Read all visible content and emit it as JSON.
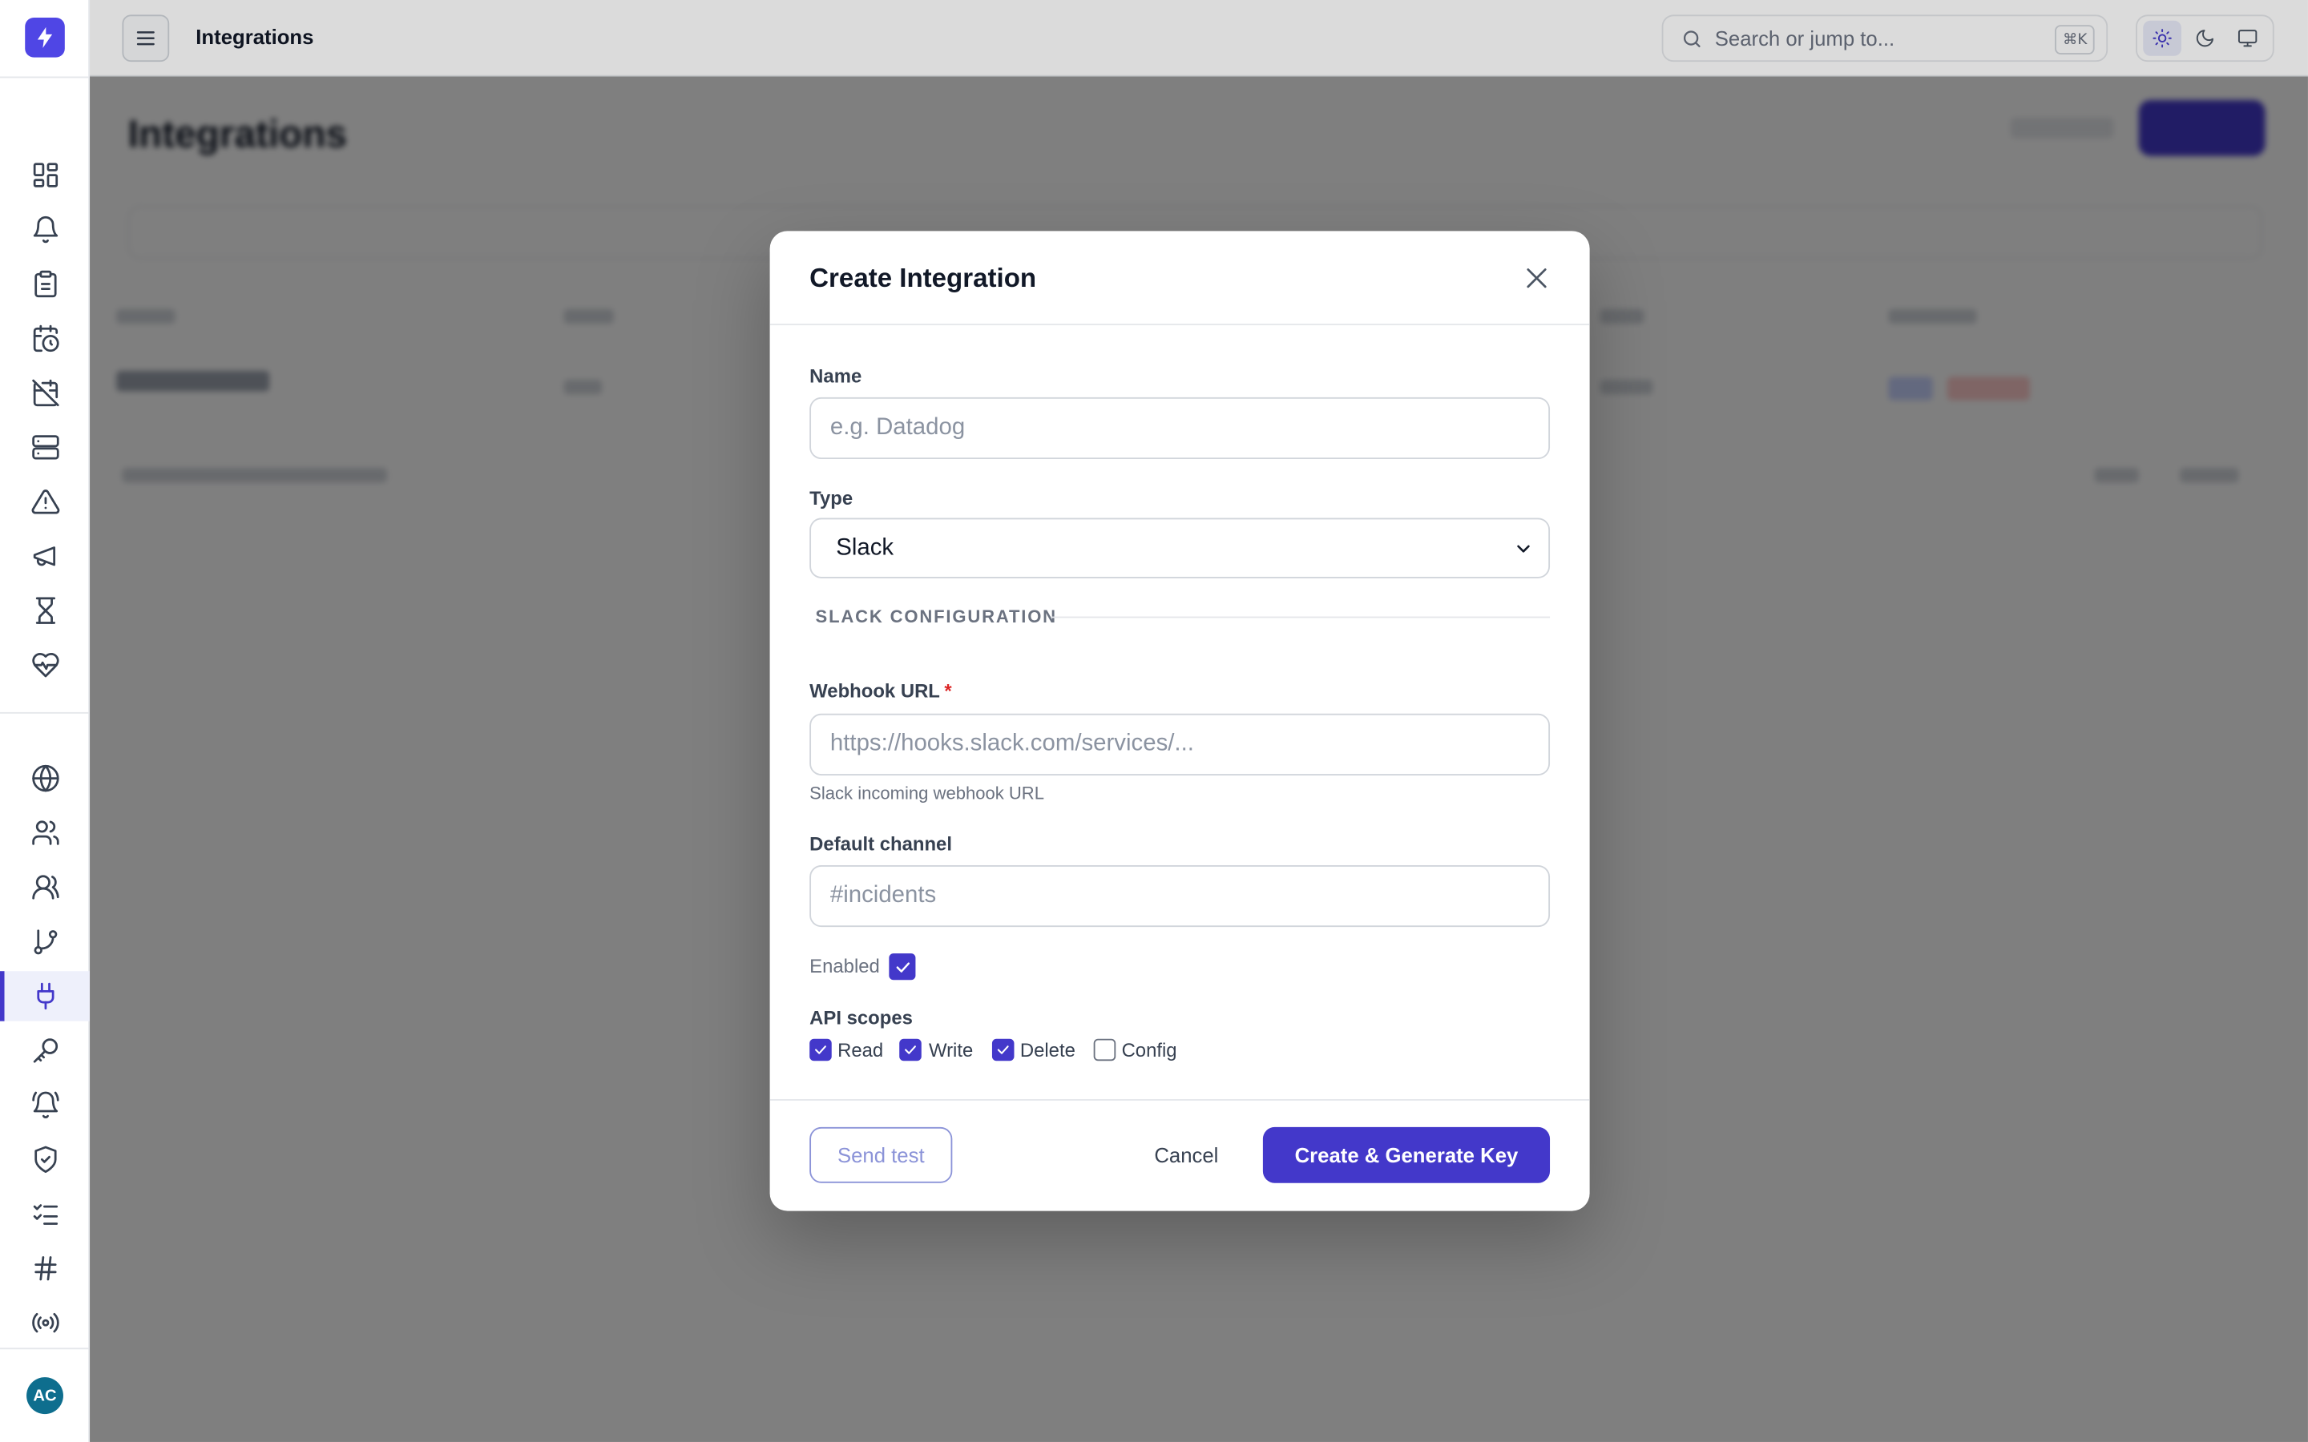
{
  "app": {
    "page_title": "Integrations",
    "background_title": "Integrations"
  },
  "topbar": {
    "menu_icon": "hamburger-icon",
    "search_placeholder": "Search or jump to...",
    "search_shortcut": "⌘K",
    "theme_options": [
      "light",
      "dark",
      "system"
    ],
    "theme_selected": "light"
  },
  "sidebar": {
    "items": [
      {
        "icon": "dashboard-icon"
      },
      {
        "icon": "bell-icon"
      },
      {
        "icon": "clipboard-icon"
      },
      {
        "icon": "calendar-clock-icon"
      },
      {
        "icon": "calendar-off-icon"
      },
      {
        "icon": "server-icon"
      },
      {
        "icon": "alert-triangle-icon"
      },
      {
        "icon": "megaphone-icon"
      },
      {
        "icon": "hourglass-icon"
      },
      {
        "icon": "heart-pulse-icon"
      },
      {
        "icon": "globe-icon"
      },
      {
        "icon": "users-icon"
      },
      {
        "icon": "team-icon"
      },
      {
        "icon": "git-branch-icon"
      },
      {
        "icon": "plug-icon",
        "active": true
      },
      {
        "icon": "key-icon"
      },
      {
        "icon": "bell-ring-icon"
      },
      {
        "icon": "shield-check-icon"
      },
      {
        "icon": "checklist-icon"
      },
      {
        "icon": "hash-icon"
      },
      {
        "icon": "radio-icon"
      }
    ],
    "avatar_initials": "AC"
  },
  "modal": {
    "title": "Create Integration",
    "name_label": "Name",
    "name_placeholder": "e.g. Datadog",
    "name_value": "",
    "type_label": "Type",
    "type_value": "Slack",
    "section_title": "SLACK CONFIGURATION",
    "webhook_label": "Webhook URL",
    "webhook_required": "*",
    "webhook_placeholder": "https://hooks.slack.com/services/...",
    "webhook_hint": "Slack incoming webhook URL",
    "channel_label": "Default channel",
    "channel_placeholder": "#incidents",
    "enabled_label": "Enabled",
    "enabled": true,
    "scopes_label": "API scopes",
    "scopes": [
      {
        "label": "Read",
        "checked": true
      },
      {
        "label": "Write",
        "checked": true
      },
      {
        "label": "Delete",
        "checked": true
      },
      {
        "label": "Config",
        "checked": false
      }
    ],
    "send_test_label": "Send test",
    "cancel_label": "Cancel",
    "submit_label": "Create & Generate Key"
  },
  "colors": {
    "accent": "#4338ca",
    "logo": "#4f46e5",
    "avatar": "#0e6e8e",
    "required": "#dc2626"
  }
}
